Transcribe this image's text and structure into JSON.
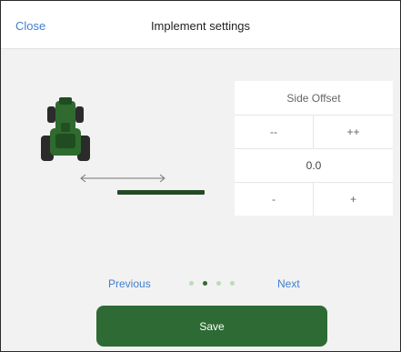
{
  "header": {
    "close_label": "Close",
    "title": "Implement settings"
  },
  "side_offset": {
    "title": "Side Offset",
    "decrement_large_label": "--",
    "increment_large_label": "++",
    "value": "0.0",
    "decrement_label": "-",
    "increment_label": "+"
  },
  "pager": {
    "previous_label": "Previous",
    "next_label": "Next",
    "page_count": 4,
    "current_page": 2
  },
  "save_label": "Save",
  "colors": {
    "accent_blue": "#3f7fcf",
    "brand_green": "#2e6b34",
    "tractor_green": "#2f6a2f",
    "implement_bar": "#234a25"
  },
  "icons": {
    "tractor": "tractor-icon",
    "width_arrow": "double-arrow-icon"
  }
}
